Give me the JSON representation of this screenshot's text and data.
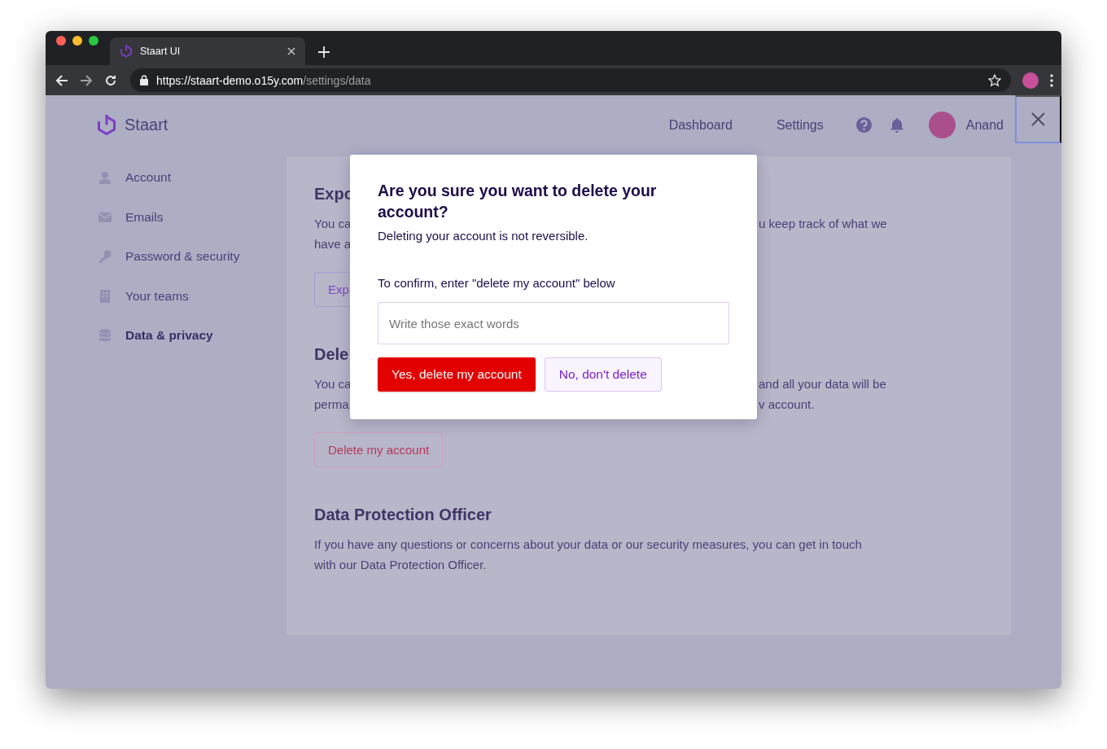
{
  "browser": {
    "tab_title": "Staart UI",
    "url_host": "https://staart-demo.o15y.com",
    "url_path": "/settings/data"
  },
  "header": {
    "brand": "Staart",
    "nav": [
      {
        "label": "Dashboard"
      },
      {
        "label": "Settings"
      }
    ],
    "user_name": "Anand"
  },
  "sidebar": {
    "items": [
      {
        "label": "Account",
        "kind": "user",
        "selected": false
      },
      {
        "label": "Emails",
        "kind": "mail",
        "selected": false
      },
      {
        "label": "Password & security",
        "kind": "key",
        "selected": false
      },
      {
        "label": "Your teams",
        "kind": "building",
        "selected": false
      },
      {
        "label": "Data & privacy",
        "kind": "database",
        "selected": true
      }
    ]
  },
  "card": {
    "sections": [
      {
        "heading": "Expo",
        "lines": [
          {
            "left": "You ca",
            "right": "u keep track of what we"
          },
          {
            "left": "have a"
          }
        ],
        "button": {
          "label": "Exp",
          "kind": "primary"
        }
      },
      {
        "heading": "Dele",
        "lines": [
          {
            "left": "You ca",
            "right": "and all your data will be"
          },
          {
            "left": "perma",
            "right": "v account."
          }
        ],
        "button": {
          "label": "Delete my account",
          "kind": "danger"
        }
      },
      {
        "heading": "Data Protection Officer",
        "text": "If you have any questions or concerns about your data or our security measures, you can get in touch with our Data Protection Officer."
      }
    ]
  },
  "modal": {
    "title": "Are you sure you want to delete your account?",
    "text": "Deleting your account is not reversible.",
    "confirm_label": "To confirm, enter \"delete my account\" below",
    "input": {
      "placeholder": "Write those exact words"
    },
    "buttons": [
      {
        "label": "Yes, delete my account",
        "kind": "danger"
      },
      {
        "label": "No, don't delete",
        "kind": "secondary"
      }
    ]
  }
}
